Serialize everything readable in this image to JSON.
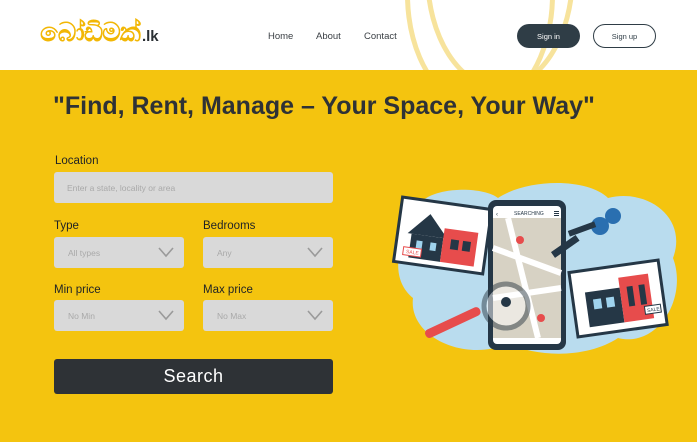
{
  "header": {
    "logo_main": "බෝඩිමක්",
    "logo_tld": ".lk",
    "nav": [
      "Home",
      "About",
      "Contact"
    ],
    "signin_label": "Sign in",
    "signup_label": "Sign up"
  },
  "hero": {
    "title": "\"Find, Rent, Manage – Your Space, Your Way\""
  },
  "form": {
    "location_label": "Location",
    "location_placeholder": "Enter a state, locality or area",
    "type_label": "Type",
    "type_value": "All types",
    "bedrooms_label": "Bedrooms",
    "bedrooms_value": "Any",
    "min_price_label": "Min price",
    "min_price_value": "No Min",
    "max_price_label": "Max price",
    "max_price_value": "No Max",
    "search_label": "Search"
  },
  "illustration": {
    "phone_header": "SEARCHING",
    "sale_tag_1": "SALE",
    "sale_tag_2": "SALE"
  },
  "colors": {
    "accent_yellow": "#f4c40f",
    "dark": "#2e3236",
    "navy_button": "#2f3d46"
  }
}
